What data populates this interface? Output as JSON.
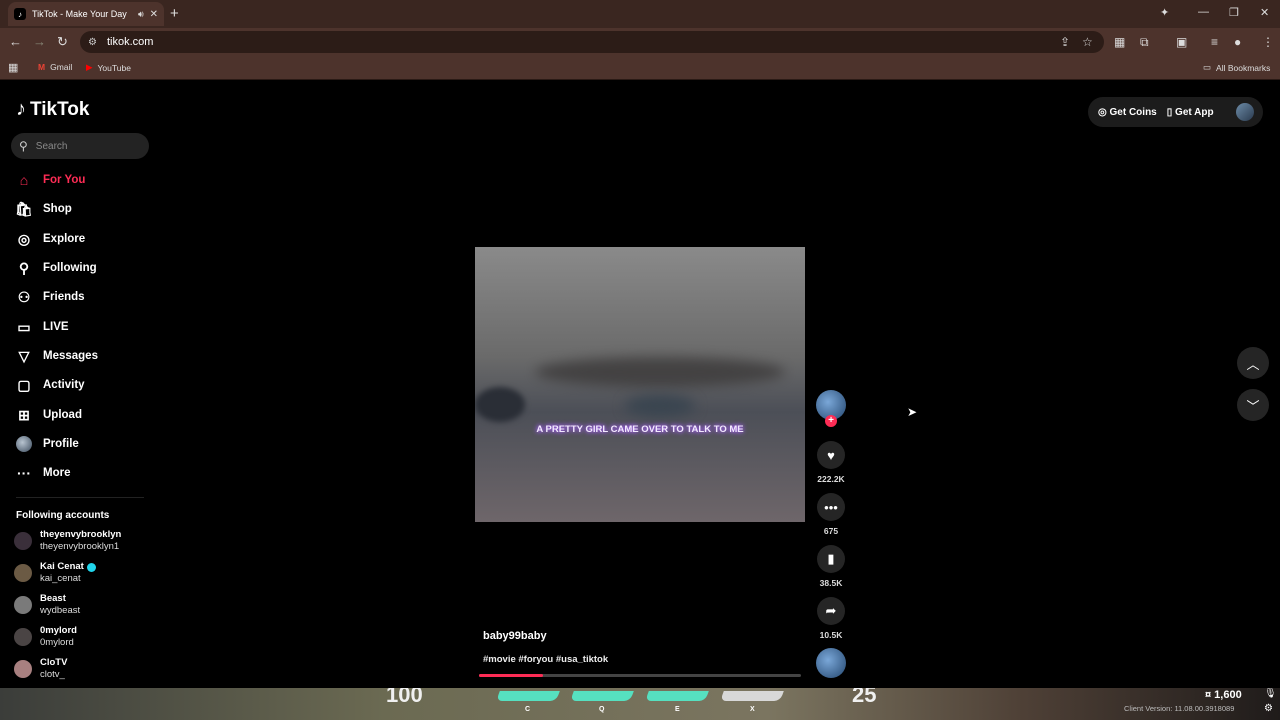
{
  "browser": {
    "tab_title": "TikTok - Make Your Day",
    "url": "tikok.com",
    "bookmarks": [
      "Gmail",
      "YouTube"
    ],
    "all_bookmarks": "All Bookmarks"
  },
  "tiktok": {
    "logo": "TikTok",
    "search_placeholder": "Search",
    "nav": [
      {
        "label": "For You",
        "icon": "home-icon"
      },
      {
        "label": "Shop",
        "icon": "shop-icon"
      },
      {
        "label": "Explore",
        "icon": "compass-icon"
      },
      {
        "label": "Following",
        "icon": "person-icon"
      },
      {
        "label": "Friends",
        "icon": "friends-icon"
      },
      {
        "label": "LIVE",
        "icon": "live-icon"
      },
      {
        "label": "Messages",
        "icon": "messages-icon"
      },
      {
        "label": "Activity",
        "icon": "activity-icon"
      },
      {
        "label": "Upload",
        "icon": "upload-icon"
      },
      {
        "label": "Profile",
        "icon": "avatar"
      },
      {
        "label": "More",
        "icon": "more-icon"
      }
    ],
    "following_title": "Following accounts",
    "accounts": [
      {
        "name": "theyenvybrooklyn",
        "handle": "theyenvybrooklyn1"
      },
      {
        "name": "Kai Cenat",
        "handle": "kai_cenat",
        "verified": true
      },
      {
        "name": "Beast",
        "handle": "wydbeast"
      },
      {
        "name": "0mylord",
        "handle": "0mylord"
      },
      {
        "name": "CloTV",
        "handle": "clotv_"
      }
    ],
    "get_coins": "Get Coins",
    "get_app": "Get App",
    "video": {
      "caption": "A PRETTY GIRL CAME OVER TO TALK TO ME",
      "username": "baby99baby",
      "hashtags": "#movie #foryou #usa_tiktok",
      "progress": 0.2,
      "likes": "222.2K",
      "comments": "675",
      "saves": "38.5K",
      "shares": "10.5K"
    }
  },
  "game_overlay": {
    "health": "100",
    "armor": "25",
    "keys": [
      "C",
      "Q",
      "E",
      "X"
    ],
    "credits": "¤ 1,600",
    "client_version": "Client Version: 11.08.00.3918089"
  }
}
